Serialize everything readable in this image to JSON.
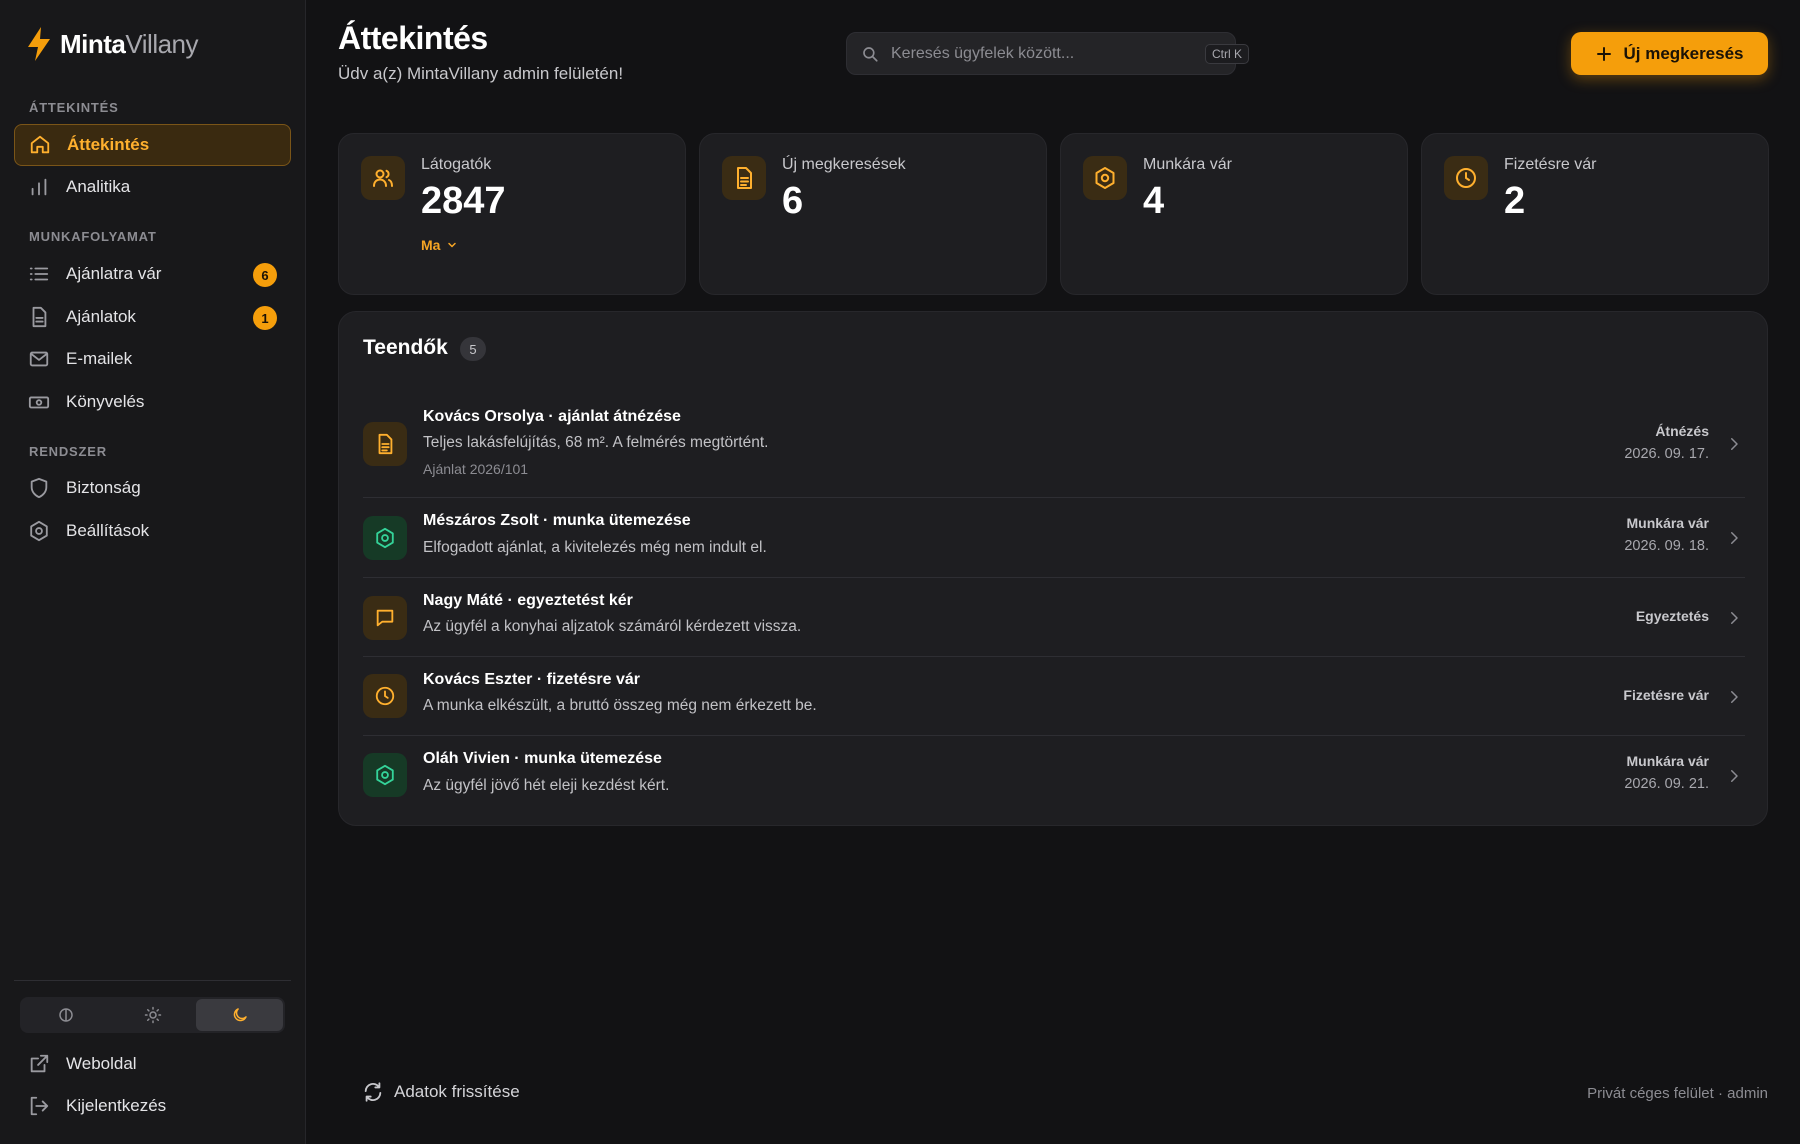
{
  "brand": {
    "name_part1": "Minta",
    "name_part2": "Villany",
    "accent": "#f59e0b"
  },
  "sidebar": {
    "sections": [
      {
        "label": "ÁTTEKINTÉS"
      },
      {
        "label": "MUNKAFOLYAMAT"
      },
      {
        "label": "RENDSZER"
      }
    ],
    "items": [
      {
        "label": "Áttekintés",
        "icon": "home-icon",
        "active": true
      },
      {
        "label": "Analitika",
        "icon": "bar-chart-icon"
      },
      {
        "label": "Ajánlatra vár",
        "icon": "list-icon",
        "badge": "6"
      },
      {
        "label": "Ajánlatok",
        "icon": "document-icon",
        "badge": "1"
      },
      {
        "label": "E-mailek",
        "icon": "mail-icon"
      },
      {
        "label": "Könyvelés",
        "icon": "banknote-icon"
      },
      {
        "label": "Biztonság",
        "icon": "shield-icon"
      },
      {
        "label": "Beállítások",
        "icon": "gear-icon"
      }
    ],
    "theme_options": [
      "system-icon",
      "sun-icon",
      "moon-icon"
    ],
    "theme_selected": "moon-icon",
    "bottom": [
      {
        "label": "Weboldal",
        "icon": "external-link-icon"
      },
      {
        "label": "Kijelentkezés",
        "icon": "logout-icon"
      }
    ]
  },
  "header": {
    "title": "Áttekintés",
    "subtitle": "Üdv a(z) MintaVillany admin felületén!",
    "search_placeholder": "Keresés ügyfelek között...",
    "search_shortcut": "Ctrl K",
    "new_button": "Új megkeresés"
  },
  "stats": [
    {
      "label": "Látogatók",
      "value": "2847",
      "filter": "Ma",
      "icon": "users-icon"
    },
    {
      "label": "Új megkeresések",
      "value": "6",
      "icon": "document-icon"
    },
    {
      "label": "Munkára vár",
      "value": "4",
      "icon": "gear-icon"
    },
    {
      "label": "Fizetésre vár",
      "value": "2",
      "icon": "clock-icon"
    }
  ],
  "todos": {
    "title": "Teendők",
    "count": "5",
    "items": [
      {
        "title": "Kovács Orsolya · ajánlat átnézése",
        "desc": "Teljes lakásfelújítás, 68 m². A felmérés megtörtént.",
        "meta": "Ajánlat 2026/101",
        "status": "Átnézés",
        "date": "2026. 09. 17.",
        "icon": "document-icon",
        "tone": "amber"
      },
      {
        "title": "Mészáros Zsolt · munka ütemezése",
        "desc": "Elfogadott ajánlat, a kivitelezés még nem indult el.",
        "status": "Munkára vár",
        "date": "2026. 09. 18.",
        "icon": "gear-icon",
        "tone": "green"
      },
      {
        "title": "Nagy Máté · egyeztetést kér",
        "desc": "Az ügyfél a konyhai aljzatok számáról kérdezett vissza.",
        "status": "Egyeztetés",
        "icon": "message-icon",
        "tone": "amber"
      },
      {
        "title": "Kovács Eszter · fizetésre vár",
        "desc": "A munka elkészült, a bruttó összeg még nem érkezett be.",
        "status": "Fizetésre vár",
        "icon": "clock-icon",
        "tone": "amber"
      },
      {
        "title": "Oláh Vivien · munka ütemezése",
        "desc": "Az ügyfél jövő hét eleji kezdést kért.",
        "status": "Munkára vár",
        "date": "2026. 09. 21.",
        "icon": "gear-icon",
        "tone": "green"
      }
    ]
  },
  "footer": {
    "refresh": "Adatok frissítése",
    "note": "Privát céges felület · admin"
  }
}
